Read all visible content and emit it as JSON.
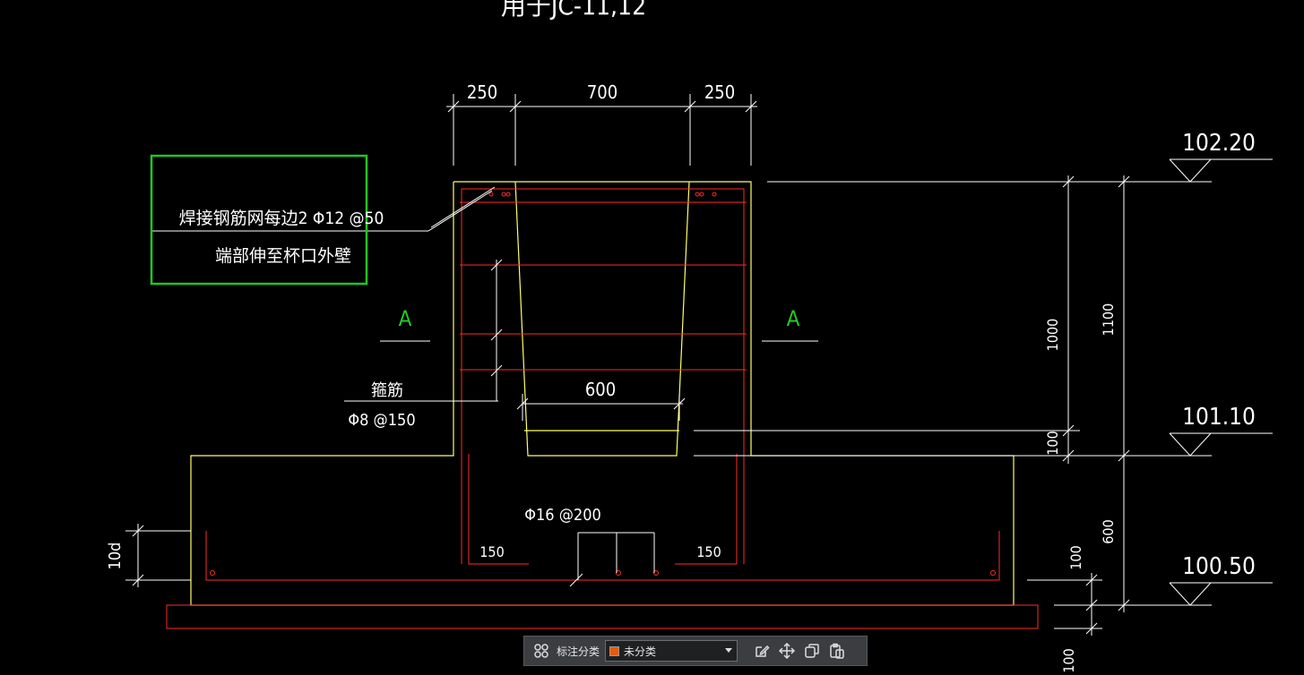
{
  "title": "用于JC-11,12",
  "dims_top": [
    "250",
    "700",
    "250"
  ],
  "dim_cup_bottom": "600",
  "dims_right_inner": [
    "1000",
    "100"
  ],
  "dims_right_outer": [
    "1100",
    "600"
  ],
  "dims_right_bottom": [
    "100",
    "100"
  ],
  "dim_left": "10d",
  "elevations": [
    "102.20",
    "101.10",
    "100.50"
  ],
  "callout": {
    "line1": "焊接钢筋网每边2 Φ12 @50",
    "line2": "端部伸至杯口外壁"
  },
  "stirrup": {
    "line1": "箍筋",
    "line2": "Φ8 @150"
  },
  "bottom_rebar": "Φ16 @200",
  "dim_150": [
    "150",
    "150"
  ],
  "section_marks": [
    "A",
    "A"
  ],
  "toolbar": {
    "category_label": "标注分类",
    "selected_category": "未分类",
    "swatch_color": "#e8590c"
  },
  "colors": {
    "outline": "#ffff66",
    "rebar": "#ff2a2a",
    "dim": "#ffffff",
    "highlight": "#22c522",
    "section": "#22cc22"
  }
}
